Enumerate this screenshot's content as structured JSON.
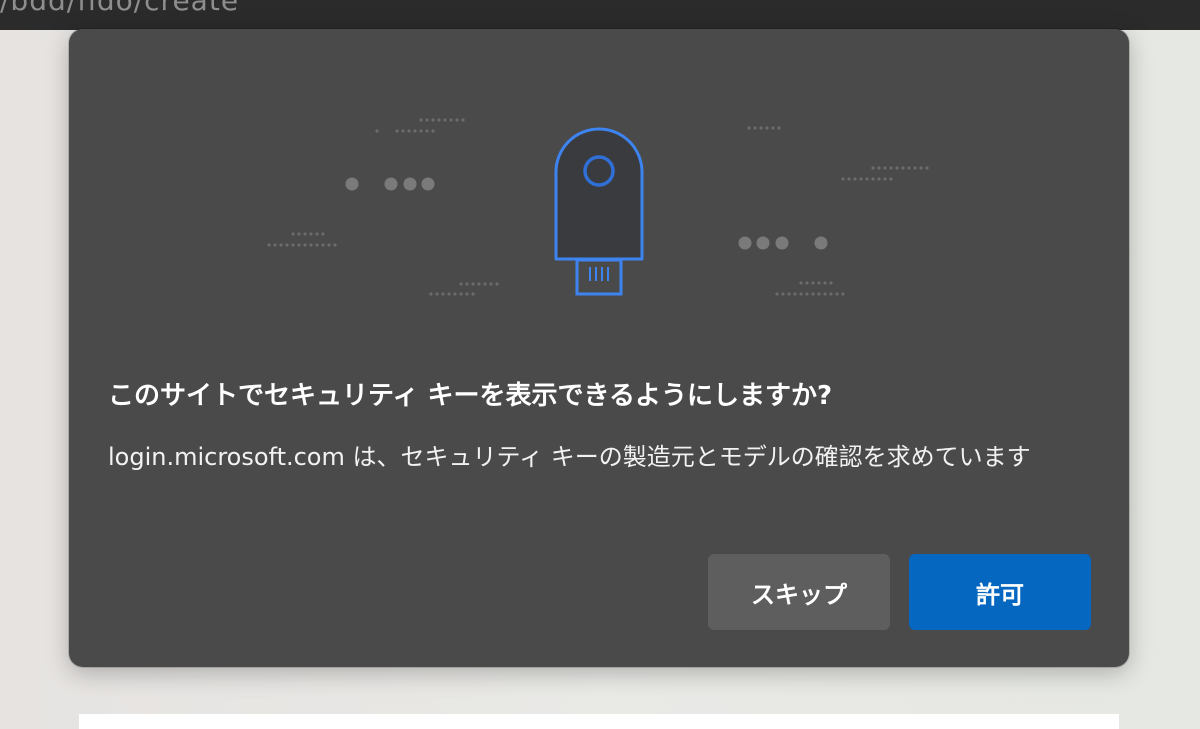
{
  "browser": {
    "address_text": "/bdd/fido/create"
  },
  "dialog": {
    "illustration_icon": "security-key-icon",
    "title": "このサイトでセキュリティ キーを表示できるようにしますか?",
    "description": "login.microsoft.com は、セキュリティ キーの製造元とモデルの確認を求めています",
    "buttons": {
      "skip_label": "スキップ",
      "allow_label": "許可"
    }
  },
  "colors": {
    "dialog_background": "#4a4a4a",
    "accent_blue": "#0667c0",
    "key_outline": "#3d84f0",
    "skip_button": "#5e5e5e"
  }
}
